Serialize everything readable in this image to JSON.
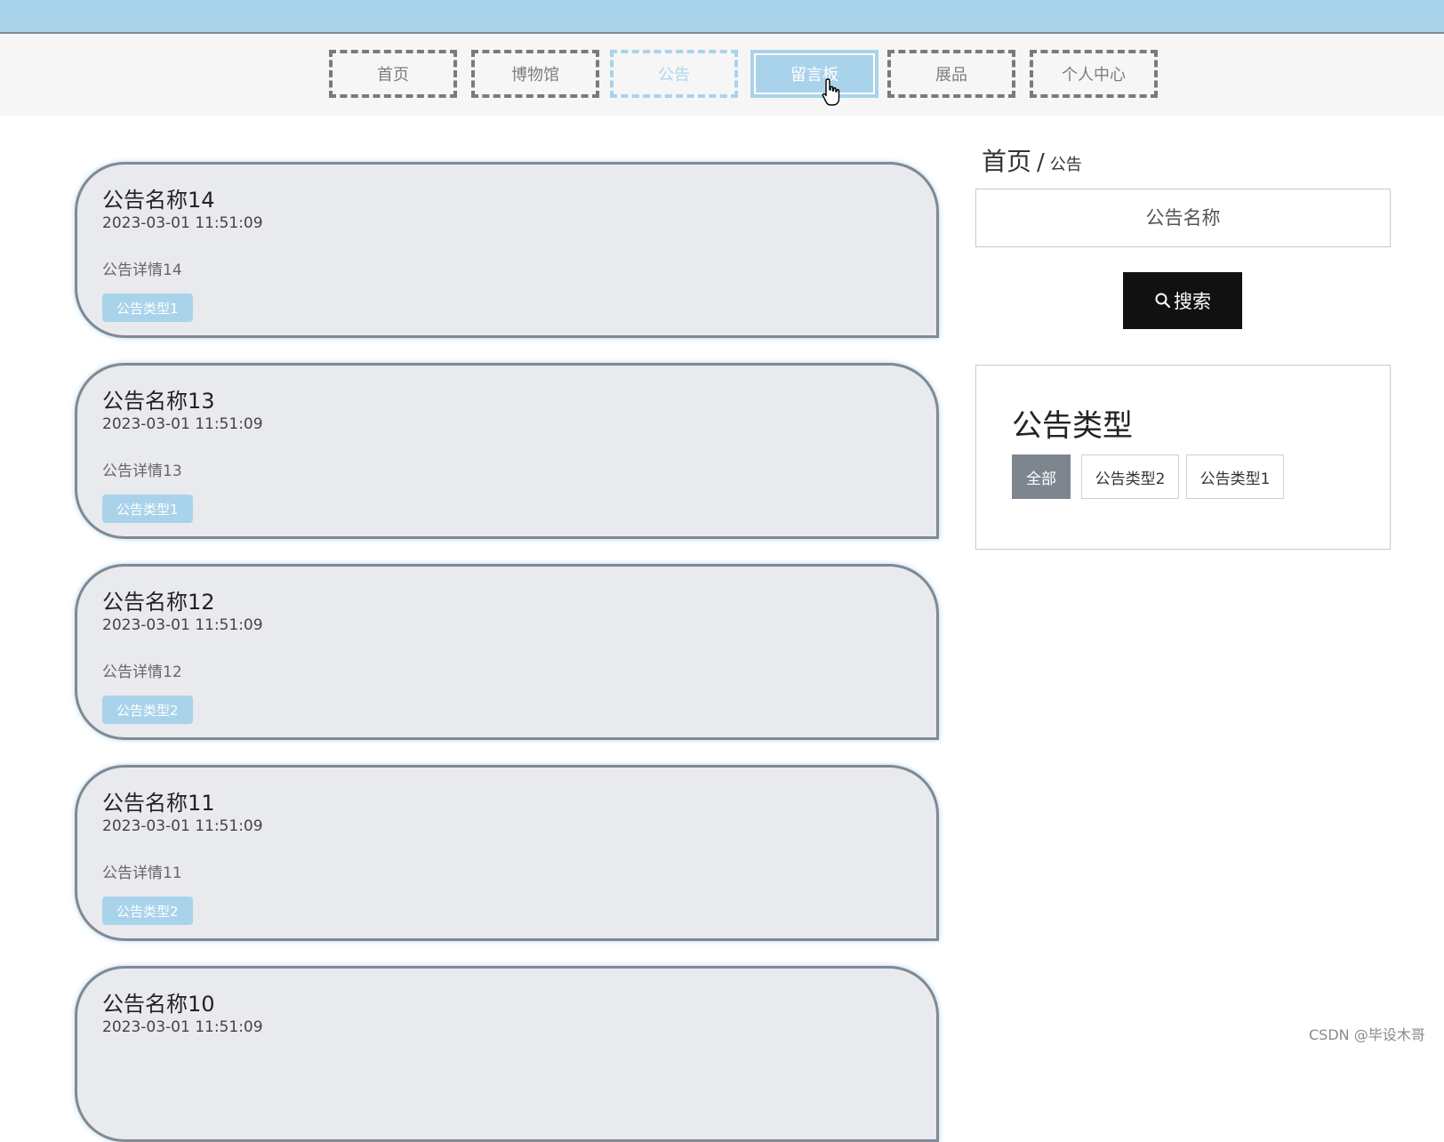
{
  "nav": {
    "items": [
      {
        "label": "首页"
      },
      {
        "label": "博物馆"
      },
      {
        "label": "公告"
      },
      {
        "label": "留言板"
      },
      {
        "label": "展品"
      },
      {
        "label": "个人中心"
      }
    ],
    "active": "公告",
    "hovered": "留言板"
  },
  "notices": [
    {
      "title": "公告名称14",
      "time": "2023-03-01 11:51:09",
      "detail": "公告详情14",
      "tag": "公告类型1"
    },
    {
      "title": "公告名称13",
      "time": "2023-03-01 11:51:09",
      "detail": "公告详情13",
      "tag": "公告类型1"
    },
    {
      "title": "公告名称12",
      "time": "2023-03-01 11:51:09",
      "detail": "公告详情12",
      "tag": "公告类型2"
    },
    {
      "title": "公告名称11",
      "time": "2023-03-01 11:51:09",
      "detail": "公告详情11",
      "tag": "公告类型2"
    },
    {
      "title": "公告名称10",
      "time": "2023-03-01 11:51:09",
      "detail": "",
      "tag": ""
    }
  ],
  "sidebar": {
    "breadcrumb": {
      "home": "首页",
      "separator": "/",
      "current": "公告"
    },
    "search": {
      "placeholder": "公告名称",
      "value": "",
      "button_label": "搜索"
    },
    "types": {
      "title": "公告类型",
      "options": [
        {
          "label": "全部",
          "selected": true
        },
        {
          "label": "公告类型2",
          "selected": false
        },
        {
          "label": "公告类型1",
          "selected": false
        }
      ]
    }
  },
  "watermark": "CSDN @毕设木哥",
  "colors": {
    "accent": "#a9d3ea",
    "nav_border": "#7a7a7a",
    "card_bg": "#e9eaed",
    "selected_type": "#7d868e",
    "search_button": "#111111"
  }
}
